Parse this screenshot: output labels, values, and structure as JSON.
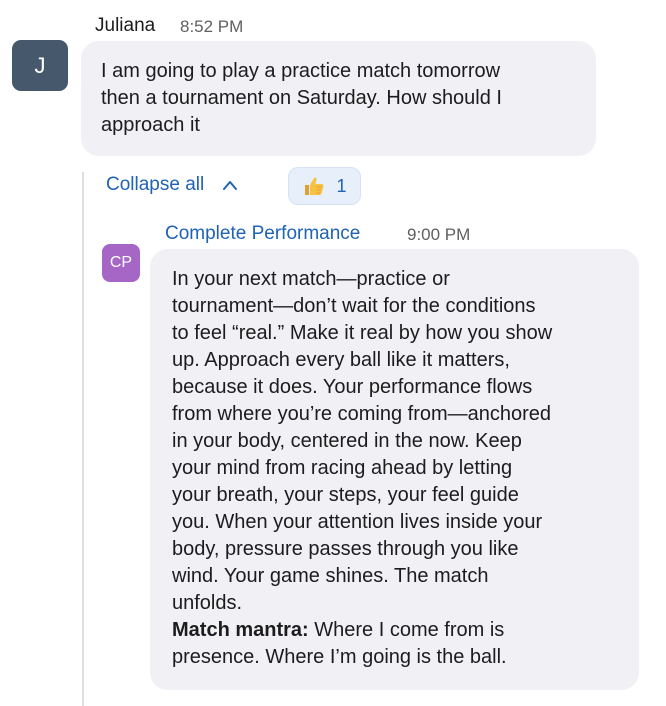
{
  "message1": {
    "avatar_initial": "J",
    "sender": "Juliana",
    "time": "8:52 PM",
    "lines": [
      "I am going to play a practice match tomorrow",
      "then a tournament on Saturday. How should I",
      "approach it"
    ]
  },
  "thread": {
    "collapse_label": "Collapse all",
    "reaction": {
      "emoji_icon": "thumbs-up-icon",
      "count": "1"
    }
  },
  "message2": {
    "avatar_initials": "CP",
    "sender": "Complete Performance",
    "time": "9:00 PM",
    "lines": [
      "In your next match—practice or",
      "tournament—don’t wait for the conditions",
      "to feel “real.” Make it real by how you show",
      "up. Approach every ball like it matters,",
      "because it does. Your performance flows",
      "from where you’re coming from—anchored",
      "in your body, centered in the now. Keep",
      "your mind from racing ahead by letting",
      "your breath, your steps, your feel guide",
      "you. When your attention lives inside your",
      "body, pressure passes through you like",
      "wind. Your game shines. The match",
      "unfolds."
    ],
    "mantra_label": "Match mantra:",
    "mantra_line1": " Where I come from is",
    "mantra_line2": "presence. Where I’m going is the ball."
  },
  "colors": {
    "link_blue": "#1f63b4",
    "bubble_bg": "#f0f0f5",
    "avatar_j": "#46596c",
    "avatar_cp": "#a566c6",
    "reaction_bg": "#e6effa"
  }
}
